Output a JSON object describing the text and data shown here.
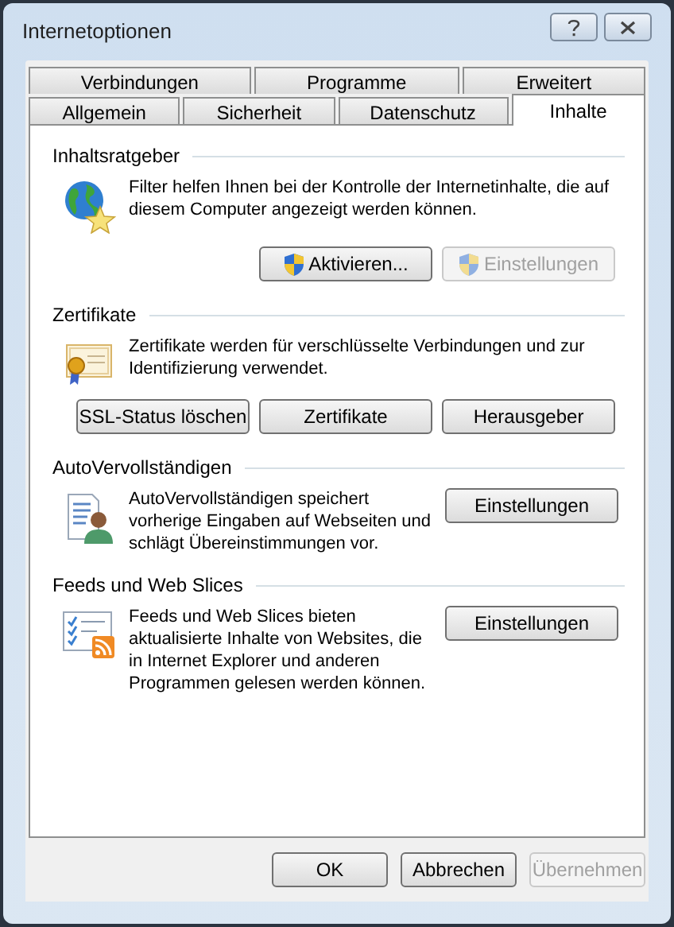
{
  "window": {
    "title": "Internetoptionen"
  },
  "tab_rows": [
    [
      {
        "label": "Verbindungen",
        "selected": false
      },
      {
        "label": "Programme",
        "selected": false
      },
      {
        "label": "Erweitert",
        "selected": false
      }
    ],
    [
      {
        "label": "Allgemein",
        "selected": false
      },
      {
        "label": "Sicherheit",
        "selected": false
      },
      {
        "label": "Datenschutz",
        "selected": false
      },
      {
        "label": "Inhalte",
        "selected": true
      }
    ]
  ],
  "sections": [
    {
      "kind": "content-advisor",
      "title": "Inhaltsratgeber",
      "description": "Filter helfen Ihnen bei der Kontrolle der Internetinhalte, die auf diesem Computer angezeigt werden können.",
      "buttons": [
        {
          "label": "Aktivieren...",
          "disabled": false,
          "shield": true
        },
        {
          "label": "Einstellungen",
          "disabled": true,
          "shield": true
        }
      ]
    },
    {
      "kind": "certificates",
      "title": "Zertifikate",
      "description": "Zertifikate werden für verschlüsselte Verbindungen und zur Identifizierung verwendet.",
      "buttons": [
        {
          "label": "SSL-Status löschen",
          "disabled": false,
          "shield": false
        },
        {
          "label": "Zertifikate",
          "disabled": false,
          "shield": false
        },
        {
          "label": "Herausgeber",
          "disabled": false,
          "shield": false
        }
      ]
    },
    {
      "kind": "autocomplete",
      "title": "AutoVervollständigen",
      "description": "AutoVervollständigen speichert vorherige Eingaben auf Webseiten und schlägt Übereinstimmungen vor.",
      "buttons": [
        {
          "label": "Einstellungen",
          "disabled": false,
          "shield": false
        }
      ]
    },
    {
      "kind": "feeds",
      "title": "Feeds und Web Slices",
      "description": "Feeds und Web Slices bieten aktualisierte Inhalte von Websites, die in Internet Explorer und anderen Programmen gelesen werden können.",
      "buttons": [
        {
          "label": "Einstellungen",
          "disabled": false,
          "shield": false
        }
      ]
    }
  ],
  "footer_buttons": [
    {
      "label": "OK",
      "disabled": false
    },
    {
      "label": "Abbrechen",
      "disabled": false
    },
    {
      "label": "Übernehmen",
      "disabled": true
    }
  ]
}
